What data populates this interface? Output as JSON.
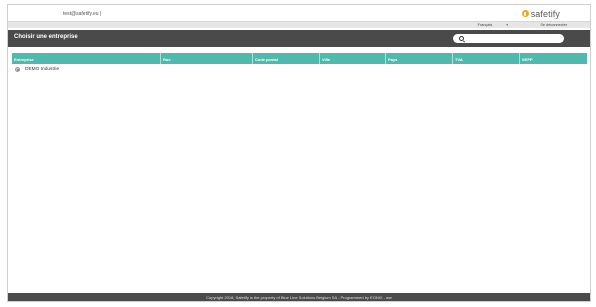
{
  "header": {
    "user_email": "test@safetify.eu |",
    "logo_text": "safetify",
    "brand_color": "#f3a51d"
  },
  "subbar": {
    "language": "Français",
    "logout": "Se déconnecter"
  },
  "page": {
    "title": "Choisir une entreprise",
    "search_placeholder": ""
  },
  "table": {
    "header_color": "#4fb9ae",
    "columns": [
      "Entreprise",
      "Rue",
      "Code postal",
      "Ville",
      "Pays",
      "TVA",
      "SEPP"
    ],
    "rows": [
      {
        "entreprise": "DEMO Industrie"
      }
    ]
  },
  "footer": {
    "text": "Copyright 2018, Safetify is the property of Blue Line Solutions Belgium SA - Programmed by EONIX - ww"
  }
}
